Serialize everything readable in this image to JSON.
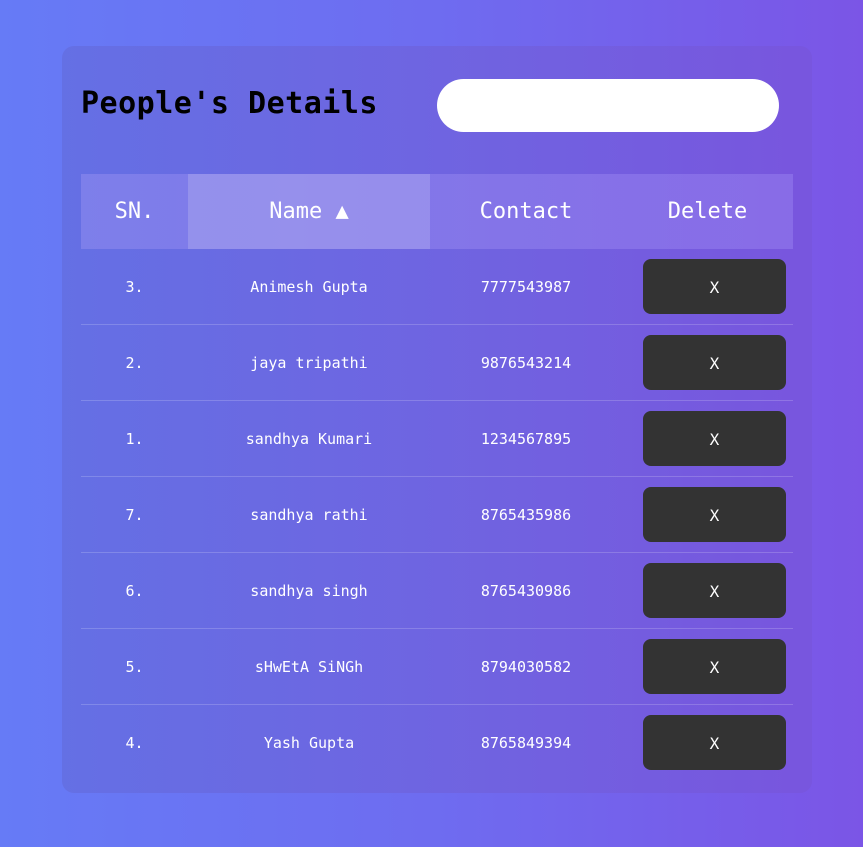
{
  "header": {
    "title": "People's Details",
    "search_value": "",
    "search_placeholder": ""
  },
  "table": {
    "columns": {
      "sn": "SN.",
      "name": "Name ▲",
      "contact": "Contact",
      "delete": "Delete"
    },
    "rows": [
      {
        "sn": "3.",
        "name": "Animesh Gupta",
        "contact": "7777543987",
        "delete": "X"
      },
      {
        "sn": "2.",
        "name": "jaya tripathi",
        "contact": "9876543214",
        "delete": "X"
      },
      {
        "sn": "1.",
        "name": "sandhya Kumari",
        "contact": "1234567895",
        "delete": "X"
      },
      {
        "sn": "7.",
        "name": "sandhya rathi",
        "contact": "8765435986",
        "delete": "X"
      },
      {
        "sn": "6.",
        "name": "sandhya singh",
        "contact": "8765430986",
        "delete": "X"
      },
      {
        "sn": "5.",
        "name": "sHwEtA SiNGh",
        "contact": "8794030582",
        "delete": "X"
      },
      {
        "sn": "4.",
        "name": "Yash Gupta",
        "contact": "8765849394",
        "delete": "X"
      }
    ]
  },
  "colors": {
    "background_start": "#667bf6",
    "background_end": "#7b55e6",
    "delete_button": "#333333",
    "text": "#ffffff"
  }
}
